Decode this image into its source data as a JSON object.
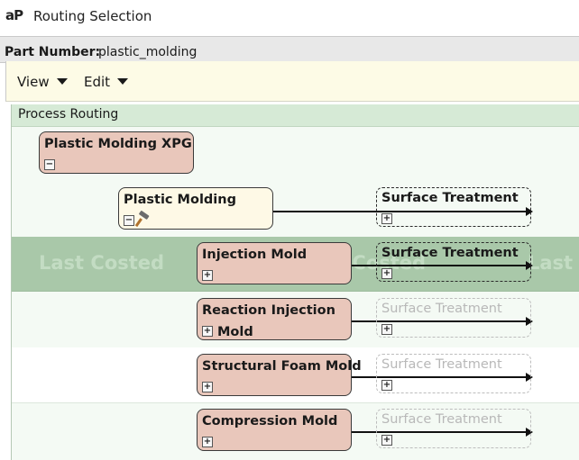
{
  "app": {
    "logo": "aP",
    "title": "Routing Selection"
  },
  "part": {
    "label": "Part Number:",
    "value": "plastic_molding"
  },
  "menu": {
    "view": "View",
    "edit": "Edit"
  },
  "routing": {
    "header": "Process Routing",
    "watermark": "Last Costed",
    "root": {
      "label": "Plastic Molding XPG",
      "toggle": "−"
    },
    "parent": {
      "label": "Plastic Molding",
      "toggle": "−",
      "icon": "hammer-icon"
    },
    "options": [
      {
        "label": "Injection Mold",
        "toggle": "+"
      },
      {
        "label": "Reaction Injection",
        "label2": "Mold",
        "toggle": "+"
      },
      {
        "label": "Structural Foam Mold",
        "toggle": "+"
      },
      {
        "label": "Compression Mold",
        "toggle": "+"
      }
    ],
    "treatment": {
      "label": "Surface Treatment",
      "toggle": "+"
    }
  }
}
